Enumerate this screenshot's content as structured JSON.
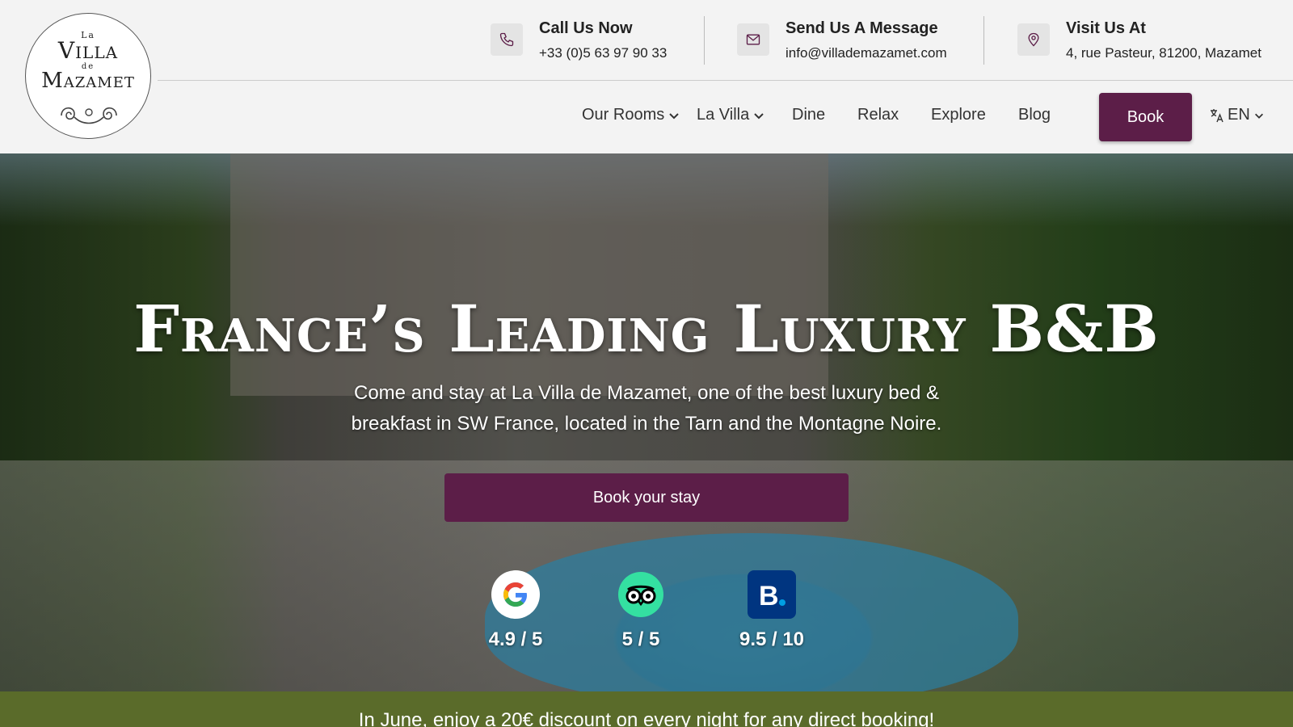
{
  "logo": {
    "line1": "La",
    "line2": "Villa",
    "line3": "de",
    "line4": "Mazamet"
  },
  "contacts": [
    {
      "title": "Call Us Now",
      "value": "+33 (0)5 63 97 90 33",
      "icon": "phone-icon"
    },
    {
      "title": "Send Us A Message",
      "value": "info@villademazamet.com",
      "icon": "envelope-icon"
    },
    {
      "title": "Visit Us At",
      "value": "4, rue Pasteur, 81200, Mazamet",
      "icon": "map-pin-icon"
    }
  ],
  "nav": {
    "items": [
      {
        "label": "Our Rooms",
        "has_dropdown": true
      },
      {
        "label": "La Villa",
        "has_dropdown": true
      },
      {
        "label": "Dine"
      },
      {
        "label": "Relax"
      },
      {
        "label": "Explore"
      },
      {
        "label": "Blog"
      }
    ],
    "book_label": "Book",
    "language": "EN"
  },
  "hero": {
    "title": "France’s Leading Luxury B&B",
    "subtitle": "Come and stay at La Villa de Mazamet, one of the best luxury bed & breakfast in SW France, located in the Tarn and the Montagne Noire.",
    "cta_label": "Book your stay"
  },
  "ratings": [
    {
      "source_icon": "google-icon",
      "score": "4.9 / 5"
    },
    {
      "source_icon": "tripadvisor-icon",
      "score": "5 / 5"
    },
    {
      "source_icon": "booking-icon",
      "score": "9.5 / 10"
    }
  ],
  "promo": {
    "text": "In June, enjoy a 20€ discount on every night for any direct booking!"
  },
  "colors": {
    "brand": "#5c1e48",
    "promo_bg": "#5a6b2a",
    "header_bg": "#f3f3f3"
  }
}
